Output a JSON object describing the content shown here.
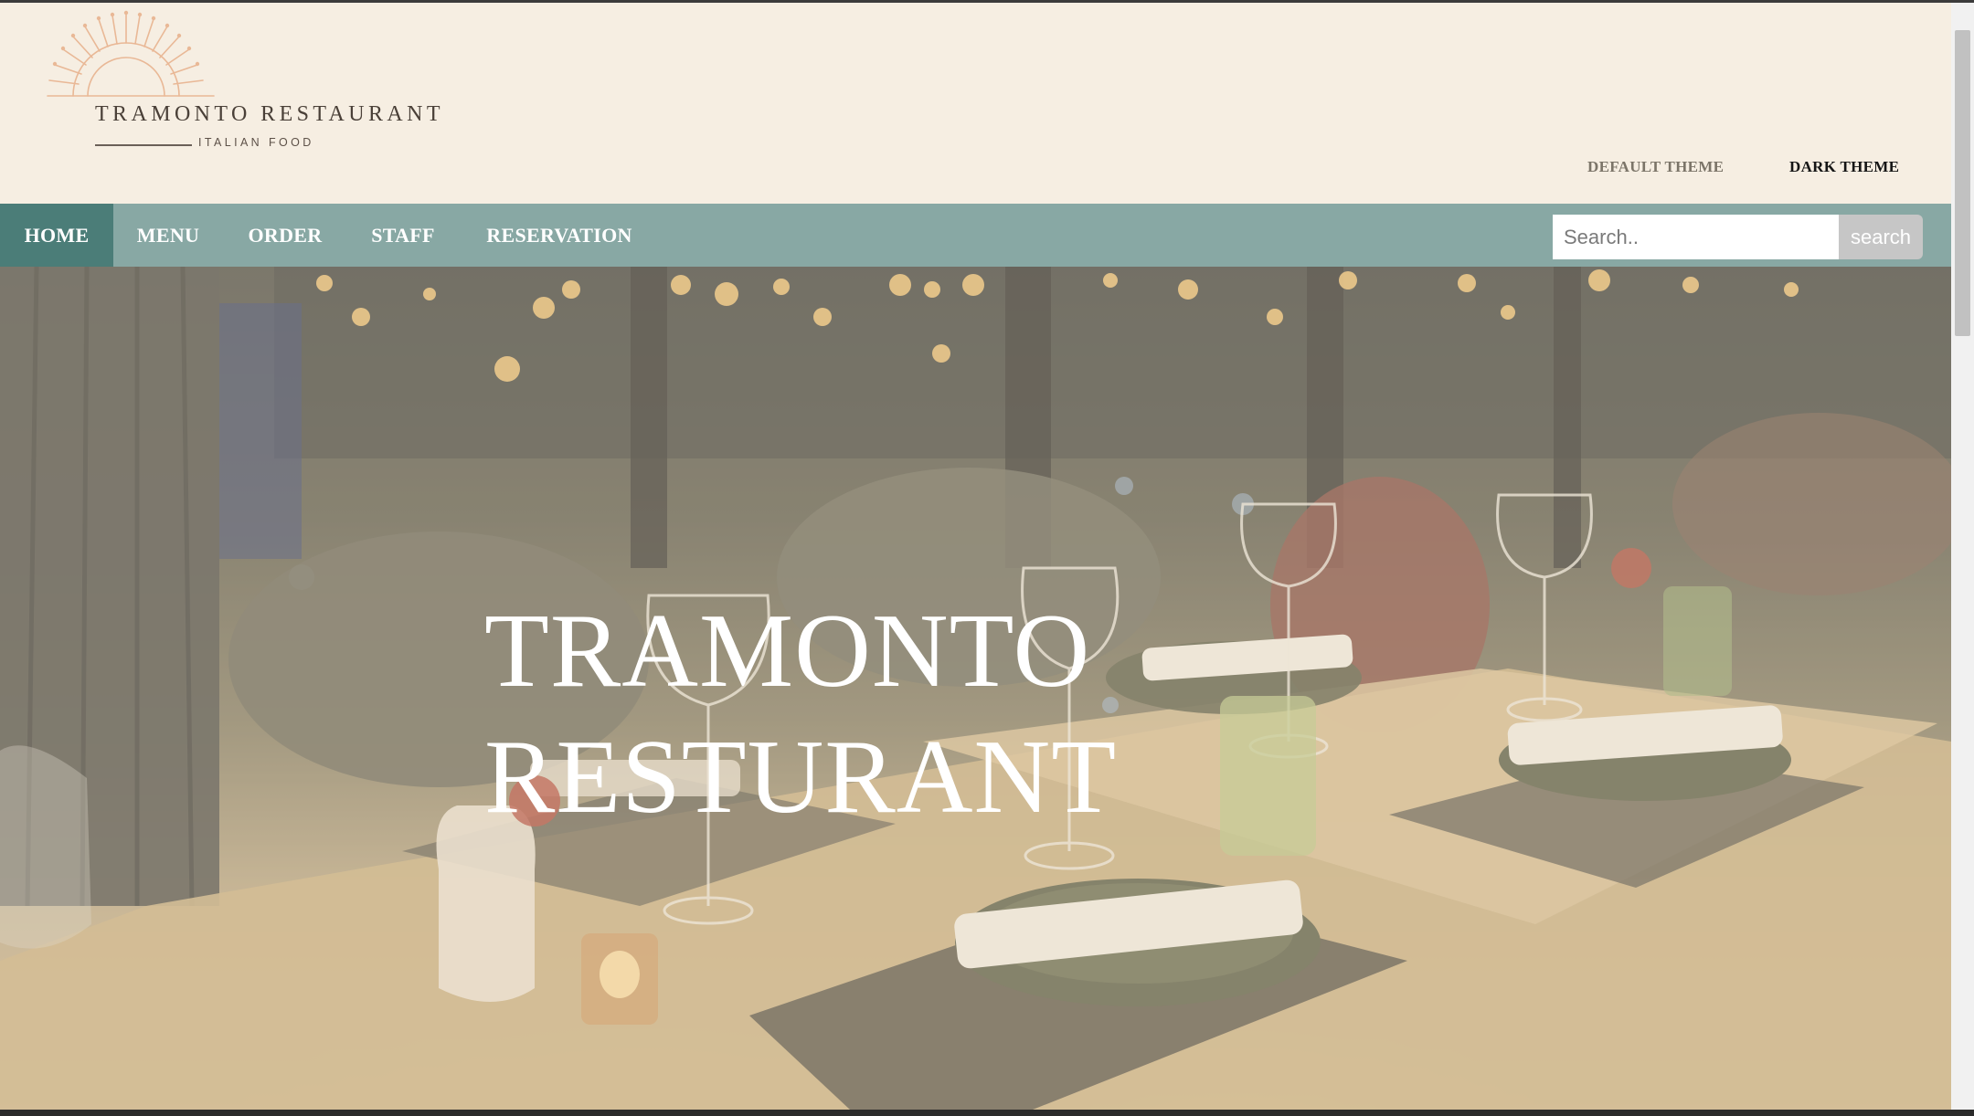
{
  "header": {
    "logo": {
      "title": "TRAMONTO RESTAURANT",
      "subtitle": "ITALIAN FOOD",
      "icon": "sunset-logo-icon",
      "color": "#e9b896"
    },
    "themes": {
      "default_label": "DEFAULT THEME",
      "dark_label": "DARK THEME"
    }
  },
  "nav": {
    "items": [
      {
        "label": "HOME",
        "active": true
      },
      {
        "label": "MENU",
        "active": false
      },
      {
        "label": "ORDER",
        "active": false
      },
      {
        "label": "STAFF",
        "active": false
      },
      {
        "label": "RESERVATION",
        "active": false
      }
    ],
    "search": {
      "placeholder": "Search..",
      "value": "",
      "button_label": "search"
    },
    "colors": {
      "bar": "#88a8a4",
      "active": "#4b7d78"
    }
  },
  "hero": {
    "title_line1": "TRAMONTO",
    "title_line2": "RESTURANT"
  },
  "colors": {
    "header_bg": "#f6eee2"
  }
}
